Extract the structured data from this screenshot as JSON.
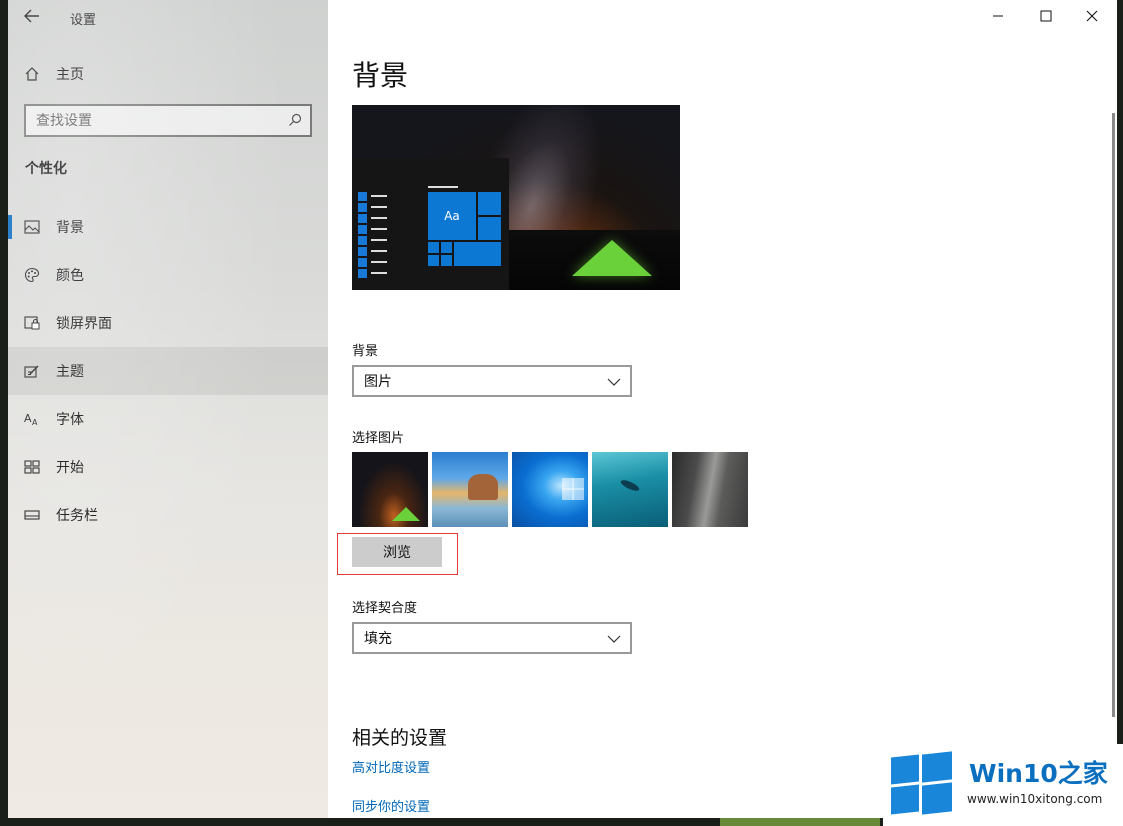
{
  "window": {
    "app_title": "设置",
    "controls": {
      "minimize": "—",
      "maximize": "☐",
      "close": "✕"
    }
  },
  "sidebar": {
    "home_label": "主页",
    "search": {
      "placeholder": "查找设置"
    },
    "section_title": "个性化",
    "items": [
      {
        "label": "背景",
        "icon": "picture-icon",
        "selected": true
      },
      {
        "label": "颜色",
        "icon": "palette-icon"
      },
      {
        "label": "锁屏界面",
        "icon": "lock-screen-icon"
      },
      {
        "label": "主题",
        "icon": "theme-icon",
        "hover": true
      },
      {
        "label": "字体",
        "icon": "font-icon"
      },
      {
        "label": "开始",
        "icon": "start-icon"
      },
      {
        "label": "任务栏",
        "icon": "taskbar-icon"
      }
    ]
  },
  "main": {
    "page_title": "背景",
    "preview": {
      "tile_label": "Aa"
    },
    "background_label": "背景",
    "background_value": "图片",
    "choose_picture_label": "选择图片",
    "browse_label": "浏览",
    "fit_label": "选择契合度",
    "fit_value": "填充",
    "related_title": "相关的设置",
    "links": [
      "高对比度设置",
      "同步你的设置"
    ]
  },
  "watermark": {
    "brand": "Win10",
    "brand_zh": "之家",
    "url": "www.win10xitong.com"
  },
  "colors": {
    "accent": "#0067c0",
    "link": "#0067b8",
    "highlight_frame": "#e23a3a"
  }
}
